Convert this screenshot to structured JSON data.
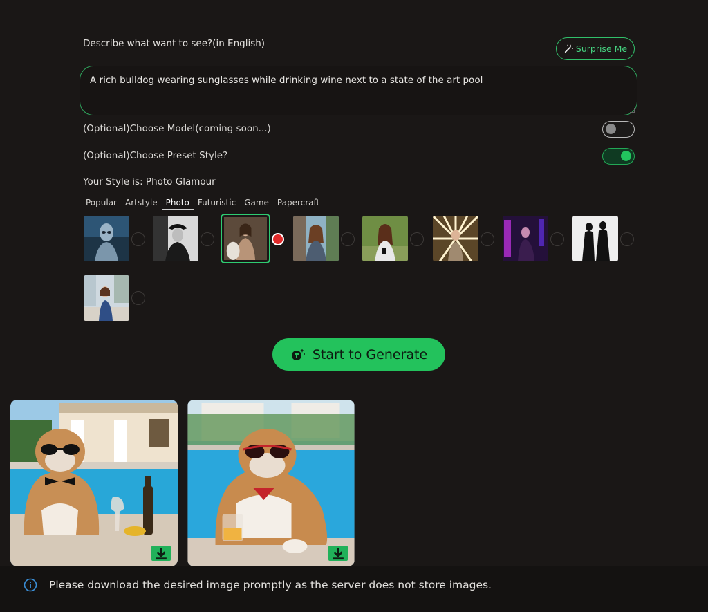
{
  "prompt": {
    "label": "Describe what want to see?(in English)",
    "value": "A rich bulldog wearing sunglasses while drinking wine next to a state of the art pool",
    "surprise_label": "Surprise Me"
  },
  "options": {
    "model_label": "(Optional)Choose Model(coming soon...)",
    "model_enabled": false,
    "preset_label": "(Optional)Choose Preset Style?",
    "preset_enabled": true
  },
  "style": {
    "current": "Your Style is: Photo Glamour",
    "tabs": [
      "Popular",
      "Artstyle",
      "Photo",
      "Futuristic",
      "Game",
      "Papercraft"
    ],
    "active_tab": "Photo",
    "thumbnails": [
      "alien-portrait",
      "noir-portrait",
      "glamour-portrait",
      "street-portrait",
      "park-portrait",
      "rays-portrait",
      "neon-portrait",
      "silhouette-portrait",
      "child-portrait"
    ],
    "selected_index": 2
  },
  "generate": {
    "label": "Start to Generate"
  },
  "results": [
    {
      "name": "bulldog-bowtie-wine"
    },
    {
      "name": "bulldog-red-sunglasses"
    }
  ],
  "notice": {
    "text": "Please download the desired image promptly as the server does not store images."
  },
  "colors": {
    "accent": "#23c25c",
    "background": "#1a1716",
    "selected_radio": "#e02a2a"
  }
}
